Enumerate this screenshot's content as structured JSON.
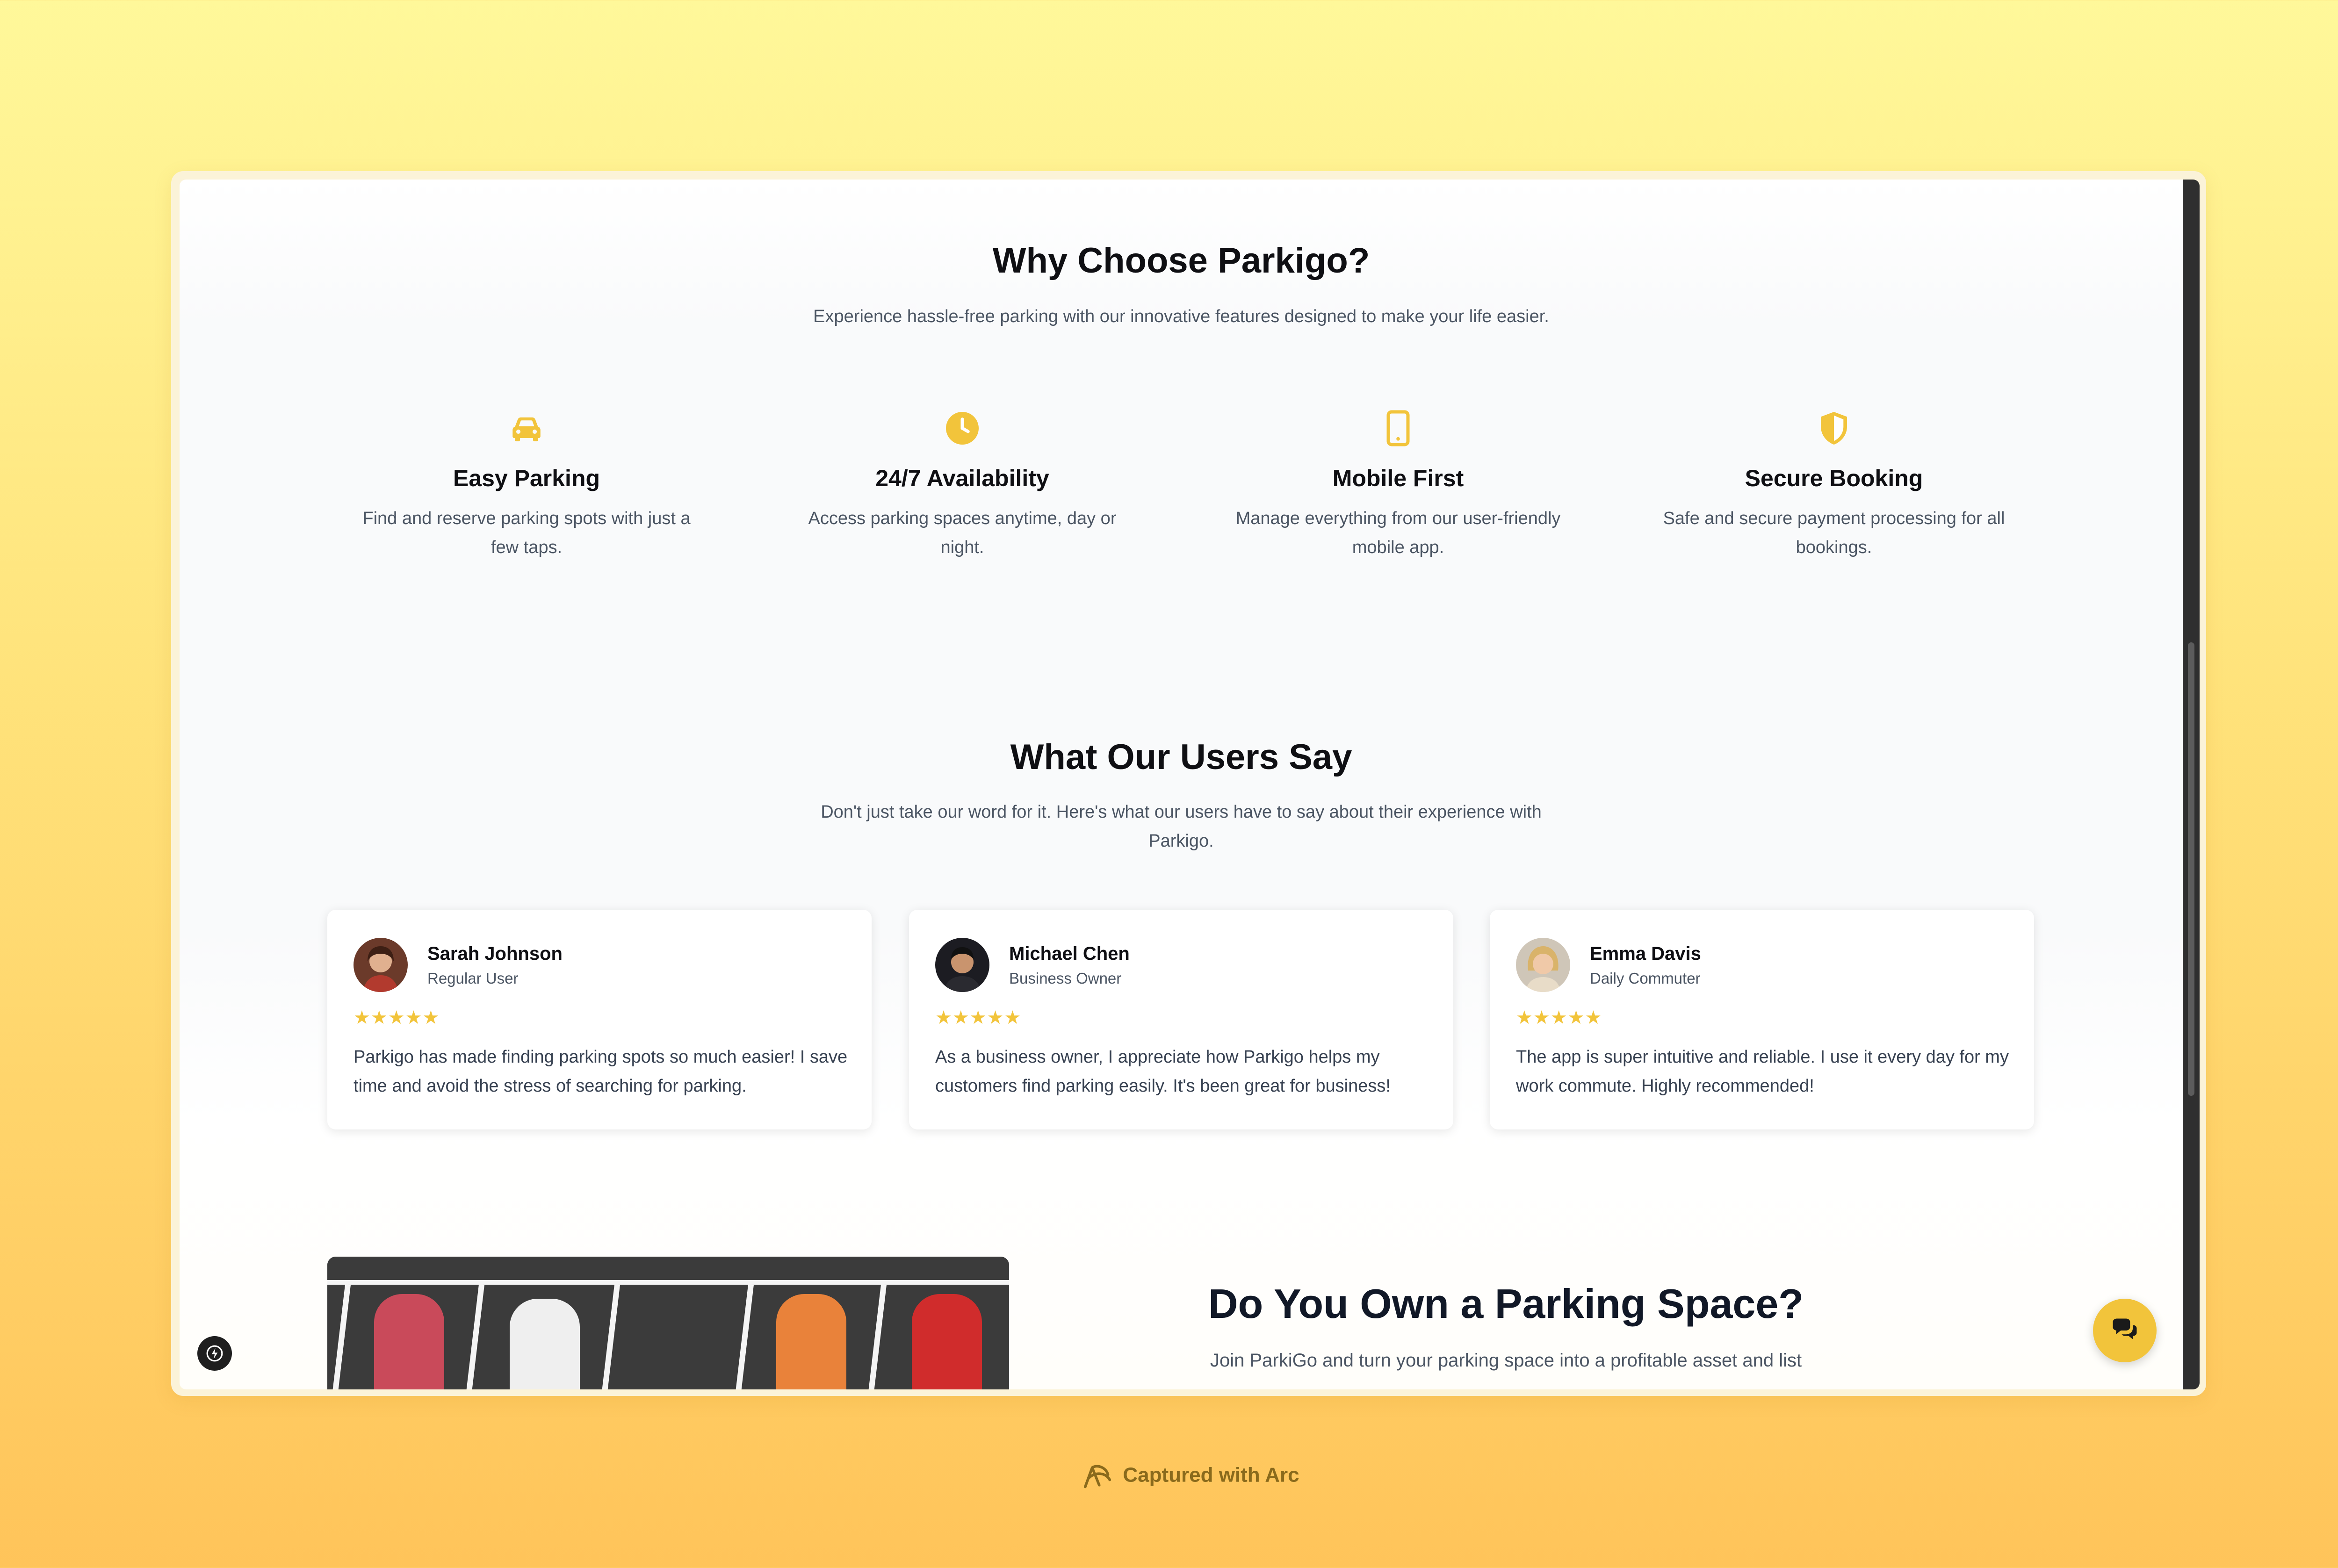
{
  "features_section": {
    "title": "Why Choose Parkigo?",
    "subtitle": "Experience hassle-free parking with our innovative features designed to make your life easier.",
    "items": [
      {
        "icon": "car-icon",
        "title": "Easy Parking",
        "description": "Find and reserve parking spots with just a few taps."
      },
      {
        "icon": "clock-icon",
        "title": "24/7 Availability",
        "description": "Access parking spaces anytime, day or night."
      },
      {
        "icon": "phone-icon",
        "title": "Mobile First",
        "description": "Manage everything from our user-friendly mobile app."
      },
      {
        "icon": "shield-icon",
        "title": "Secure Booking",
        "description": "Safe and secure payment processing for all bookings."
      }
    ]
  },
  "testimonials_section": {
    "title": "What Our Users Say",
    "subtitle": "Don't just take our word for it. Here's what our users have to say about their experience with Parkigo.",
    "items": [
      {
        "name": "Sarah Johnson",
        "role": "Regular User",
        "rating": 5,
        "stars": "★★★★★",
        "quote": "Parkigo has made finding parking spots so much easier! I save time and avoid the stress of searching for parking."
      },
      {
        "name": "Michael Chen",
        "role": "Business Owner",
        "rating": 5,
        "stars": "★★★★★",
        "quote": "As a business owner, I appreciate how Parkigo helps my customers find parking easily. It's been great for business!"
      },
      {
        "name": "Emma Davis",
        "role": "Daily Commuter",
        "rating": 5,
        "stars": "★★★★★",
        "quote": "The app is super intuitive and reliable. I use it every day for my work commute. Highly recommended!"
      }
    ]
  },
  "owner_section": {
    "title": "Do You Own a Parking Space?",
    "text": "Join ParkiGo and turn your parking space into a profitable asset and list"
  },
  "chat_button": {
    "icon": "chat-icon"
  },
  "capture_label": "Captured with Arc",
  "colors": {
    "accent": "#f2c43b",
    "heading": "#0f0f13",
    "body": "#4b5563"
  }
}
